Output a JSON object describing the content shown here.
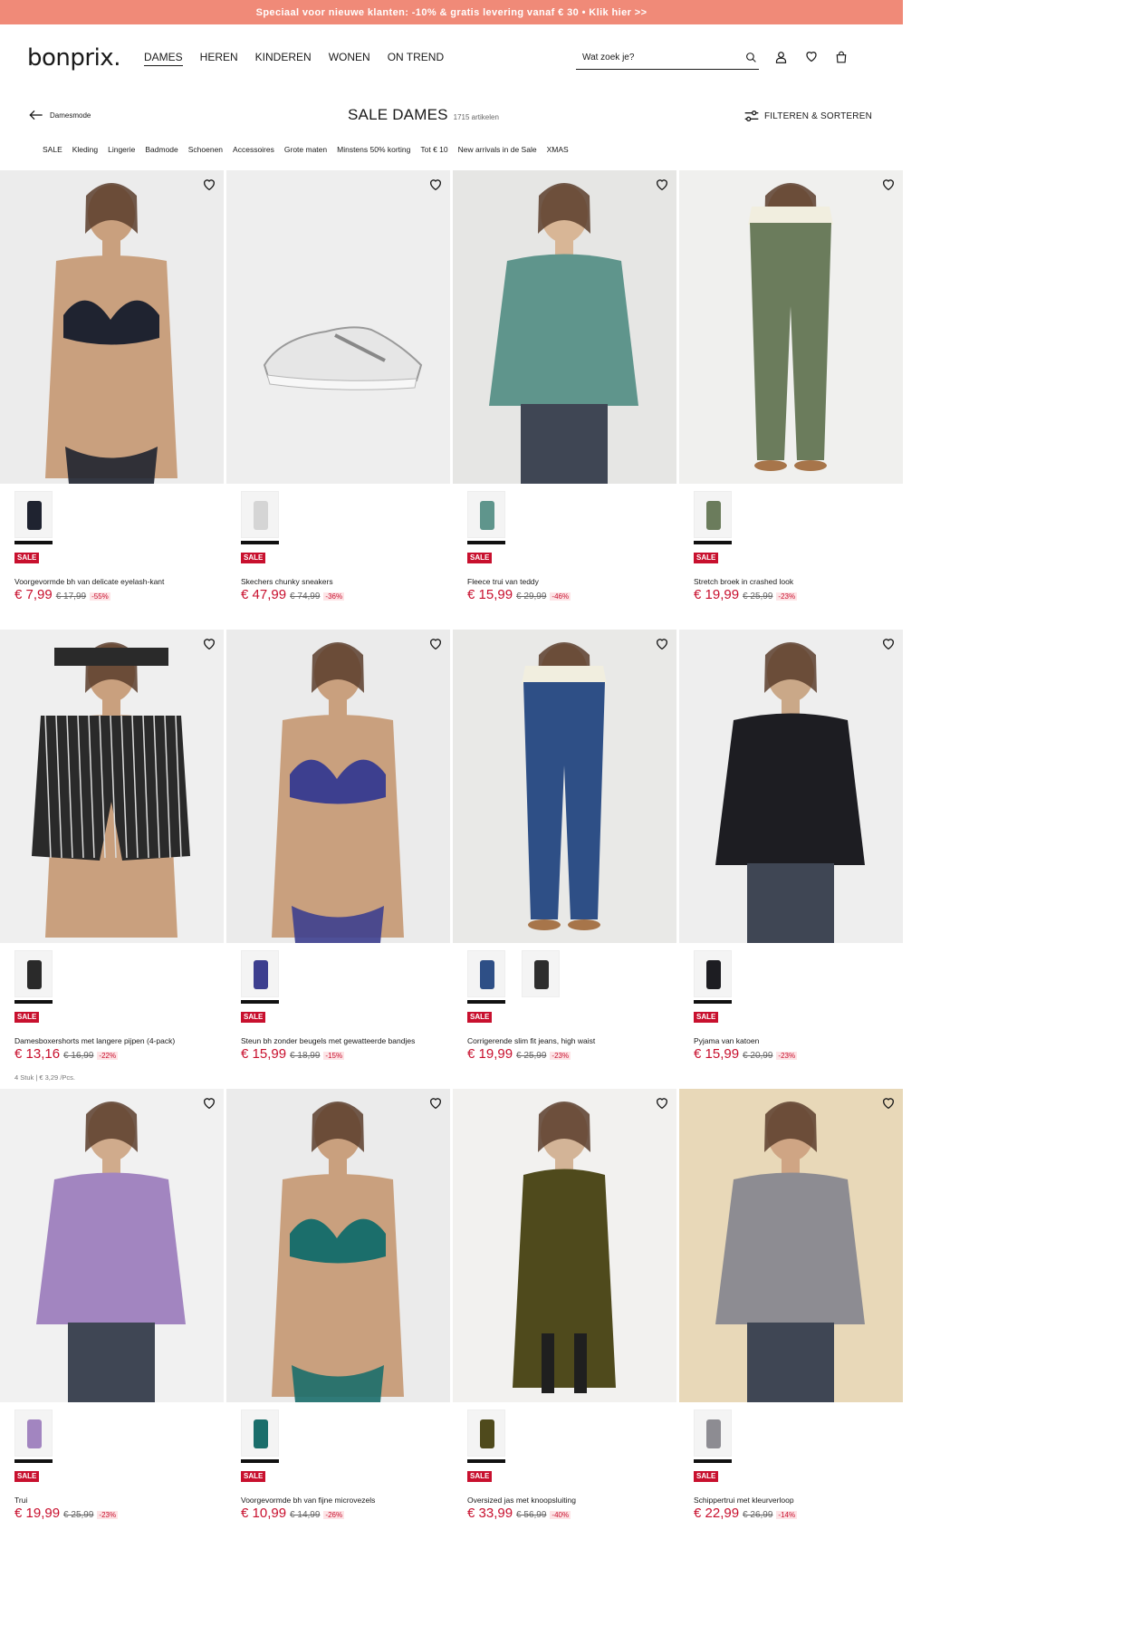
{
  "promo": "Speciaal voor nieuwe klanten: -10% & gratis levering vanaf € 30 • Klik hier >>",
  "logo": "bonprix.",
  "nav": [
    "DAMES",
    "HEREN",
    "KINDEREN",
    "WONEN",
    "ON TREND"
  ],
  "search_placeholder": "Wat zoek je?",
  "back_label": "Damesmode",
  "page_title": "SALE DAMES",
  "article_count": "1715 artikelen",
  "filter_label": "FILTEREN & SORTEREN",
  "subnav": [
    "SALE",
    "Kleding",
    "Lingerie",
    "Badmode",
    "Schoenen",
    "Accessoires",
    "Grote maten",
    "Minstens 50% korting",
    "Tot € 10",
    "New arrivals in de Sale",
    "XMAS"
  ],
  "badge": "SALE",
  "products": [
    {
      "name": "Voorgevormde bh van delicate eyelash-kant",
      "price": "€ 7,99",
      "old": "€ 17,99",
      "discount": "-55%",
      "note": "",
      "swatches": 1
    },
    {
      "name": "Skechers chunky sneakers",
      "price": "€ 47,99",
      "old": "€ 74,99",
      "discount": "-36%",
      "note": "",
      "swatches": 1
    },
    {
      "name": "Fleece trui van teddy",
      "price": "€ 15,99",
      "old": "€ 29,99",
      "discount": "-46%",
      "note": "",
      "swatches": 1
    },
    {
      "name": "Stretch broek in crashed look",
      "price": "€ 19,99",
      "old": "€ 25,99",
      "discount": "-23%",
      "note": "",
      "swatches": 1
    },
    {
      "name": "Damesboxershorts met langere pijpen (4-pack)",
      "price": "€ 13,16",
      "old": "€ 16,99",
      "discount": "-22%",
      "note": "4 Stuk | € 3,29 /Pcs.",
      "swatches": 1
    },
    {
      "name": "Steun bh zonder beugels met gewatteerde bandjes",
      "price": "€ 15,99",
      "old": "€ 18,99",
      "discount": "-15%",
      "note": "",
      "swatches": 1
    },
    {
      "name": "Corrigerende slim fit jeans, high waist",
      "price": "€ 19,99",
      "old": "€ 25,99",
      "discount": "-23%",
      "note": "",
      "swatches": 2
    },
    {
      "name": "Pyjama van katoen",
      "price": "€ 15,99",
      "old": "€ 20,99",
      "discount": "-23%",
      "note": "",
      "swatches": 1
    },
    {
      "name": "Trui",
      "price": "€ 19,99",
      "old": "€ 25,99",
      "discount": "-23%",
      "note": "",
      "swatches": 1
    },
    {
      "name": "Voorgevormde bh van fijne microvezels",
      "price": "€ 10,99",
      "old": "€ 14,99",
      "discount": "-26%",
      "note": "",
      "swatches": 1
    },
    {
      "name": "Oversized jas met knoopsluiting",
      "price": "€ 33,99",
      "old": "€ 56,99",
      "discount": "-40%",
      "note": "",
      "swatches": 1
    },
    {
      "name": "Schippertrui met kleurverloop",
      "price": "€ 22,99",
      "old": "€ 26,99",
      "discount": "-14%",
      "note": "",
      "swatches": 1
    }
  ],
  "icons": {
    "search": "search-icon",
    "account": "user-icon",
    "wishlist": "heart-icon",
    "cart": "bag-icon",
    "back": "arrow-left-icon",
    "filter": "sliders-icon"
  },
  "colors": {
    "promo_bg": "#f08a78",
    "sale_red": "#c8102e"
  }
}
